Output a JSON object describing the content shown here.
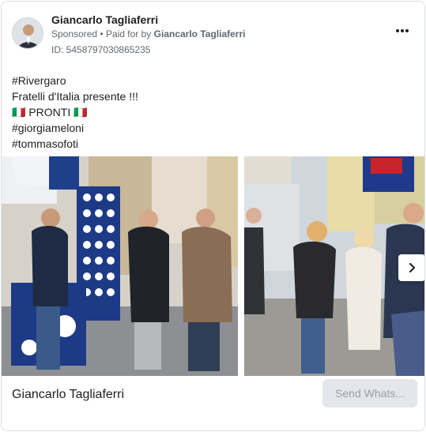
{
  "header": {
    "advertiser_name": "Giancarlo Tagliaferri",
    "sponsored_label": "Sponsored",
    "separator": "•",
    "paid_for_prefix": "Paid for by",
    "paid_for_name": "Giancarlo Tagliaferri",
    "ad_id": "ID: 5458797030865235"
  },
  "body": {
    "lines": [
      "#Rivergaro",
      "Fratelli d'Italia presente !!!",
      "🇮🇹 PRONTI 🇮🇹",
      "#giorgiameloni",
      "#tommasofoti"
    ]
  },
  "carousel": {
    "images": [
      {
        "icon": "photo-volunteers-stand"
      },
      {
        "icon": "photo-street-crowd"
      }
    ],
    "next_icon": "chevron-right-icon"
  },
  "footer": {
    "title": "Giancarlo Tagliaferri",
    "cta_label": "Send Whats..."
  },
  "colors": {
    "text_primary": "#1c1e21",
    "text_secondary": "#606770",
    "border": "#dddfe2",
    "cta_bg": "#e4e6eb",
    "cta_text": "#9a9ea5"
  }
}
